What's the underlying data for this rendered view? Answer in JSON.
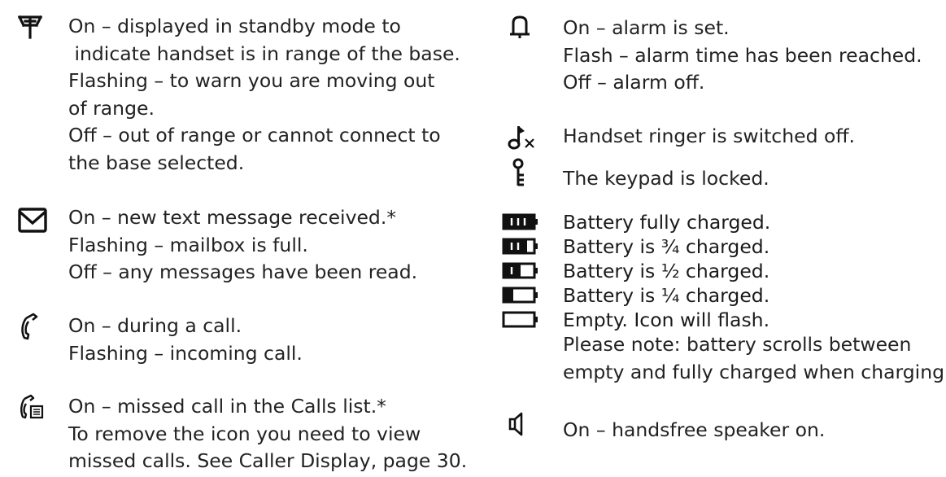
{
  "left_column": [
    {
      "icon": "antenna-icon",
      "lines": [
        "On – displayed in standby mode to",
        " indicate handset is in range of the base.",
        "Flashing – to warn you are moving out",
        "of range.",
        "Off – out of range or cannot connect to",
        "the base selected."
      ]
    },
    {
      "icon": "envelope-icon",
      "lines": [
        "On – new text message received.*",
        "Flashing – mailbox is full.",
        "Off – any messages have been read."
      ]
    },
    {
      "icon": "phone-handset-icon",
      "lines": [
        "On – during a call.",
        "Flashing – incoming call."
      ]
    },
    {
      "icon": "missed-call-icon",
      "lines": [
        "On – missed call in the Calls list.*",
        "To remove the icon you need to view",
        "missed calls. See Caller Display, page 30."
      ]
    }
  ],
  "right_column": {
    "alarm": {
      "icon": "bell-icon",
      "lines": [
        "On – alarm is set.",
        "Flash – alarm time has been reached.",
        "Off – alarm off."
      ]
    },
    "ringer": {
      "icon": "ringer-off-icon",
      "lines": [
        "Handset ringer is switched off."
      ]
    },
    "keypad": {
      "icon": "key-icon",
      "lines": [
        "The keypad is locked."
      ]
    },
    "battery": [
      {
        "icon": "battery-full-icon",
        "level": 1.0,
        "text": "Battery fully charged."
      },
      {
        "icon": "battery-three-quarter-icon",
        "level": 0.75,
        "text": "Battery is ¾ charged."
      },
      {
        "icon": "battery-half-icon",
        "level": 0.5,
        "text": "Battery is ½ charged."
      },
      {
        "icon": "battery-quarter-icon",
        "level": 0.25,
        "text": "Battery is ¼ charged."
      },
      {
        "icon": "battery-empty-icon",
        "level": 0.0,
        "text": "Empty. Icon will flash."
      }
    ],
    "battery_note": [
      "Please note: battery scrolls between",
      "empty and fully charged when charging."
    ],
    "speaker": {
      "icon": "speaker-icon",
      "lines": [
        "On – handsfree speaker on."
      ]
    }
  }
}
